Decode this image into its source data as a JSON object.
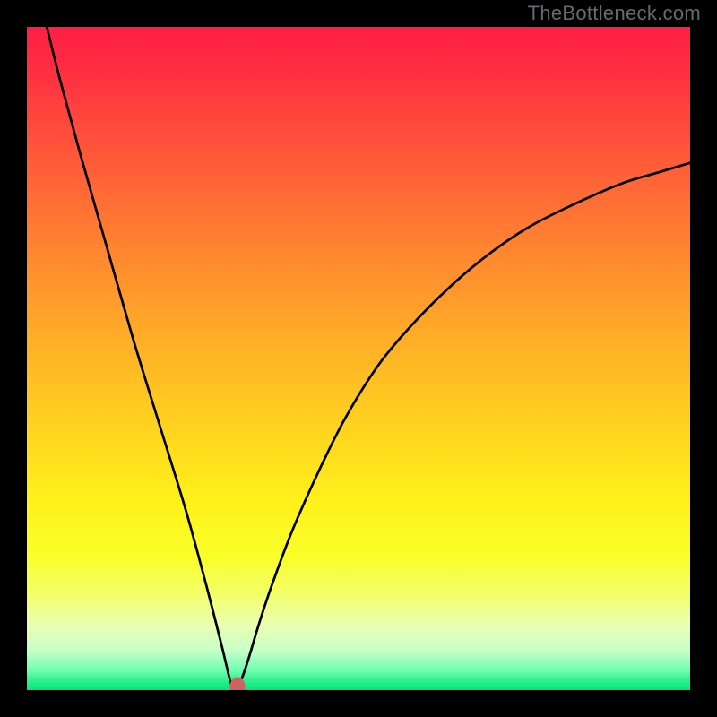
{
  "watermark": "TheBottleneck.com",
  "chart_data": {
    "type": "line",
    "title": "",
    "xlabel": "",
    "ylabel": "",
    "xlim": [
      0,
      100
    ],
    "ylim": [
      0,
      100
    ],
    "grid": false,
    "legend": false,
    "background": {
      "type": "vertical-gradient",
      "stops": [
        {
          "pos": 0.0,
          "color": "#ff1f44"
        },
        {
          "pos": 0.05,
          "color": "#ff2a42"
        },
        {
          "pos": 0.15,
          "color": "#ff4a3c"
        },
        {
          "pos": 0.3,
          "color": "#ff7a32"
        },
        {
          "pos": 0.45,
          "color": "#ffa828"
        },
        {
          "pos": 0.6,
          "color": "#ffd21f"
        },
        {
          "pos": 0.72,
          "color": "#fff21a"
        },
        {
          "pos": 0.8,
          "color": "#faff2a"
        },
        {
          "pos": 0.86,
          "color": "#f2ff70"
        },
        {
          "pos": 0.9,
          "color": "#eaffb0"
        },
        {
          "pos": 0.94,
          "color": "#c8ffc8"
        },
        {
          "pos": 0.97,
          "color": "#70ffb0"
        },
        {
          "pos": 0.985,
          "color": "#30f090"
        },
        {
          "pos": 1.0,
          "color": "#00e878"
        }
      ]
    },
    "series": [
      {
        "name": "bottleneck-curve",
        "color": "#000000",
        "width": 2.7,
        "x": [
          0.0,
          1.0,
          3.0,
          5.0,
          8.0,
          12.0,
          16.0,
          20.0,
          24.0,
          27.0,
          29.3,
          30.5,
          31.0,
          31.7,
          32.5,
          33.5,
          35.0,
          37.0,
          40.0,
          44.0,
          48.0,
          53.0,
          58.0,
          64.0,
          70.0,
          76.0,
          83.0,
          90.0,
          95.0,
          100.0
        ],
        "values": [
          113.0,
          108.0,
          100.0,
          92.0,
          81.0,
          67.0,
          53.0,
          40.0,
          27.0,
          16.0,
          7.0,
          2.0,
          0.5,
          0.5,
          2.0,
          5.0,
          10.0,
          16.0,
          24.0,
          33.0,
          41.0,
          49.0,
          55.0,
          61.0,
          66.0,
          70.0,
          73.5,
          76.5,
          78.0,
          79.5
        ]
      }
    ],
    "marker": {
      "x": 31.7,
      "y": 0.5,
      "color": "#c9645e"
    }
  }
}
